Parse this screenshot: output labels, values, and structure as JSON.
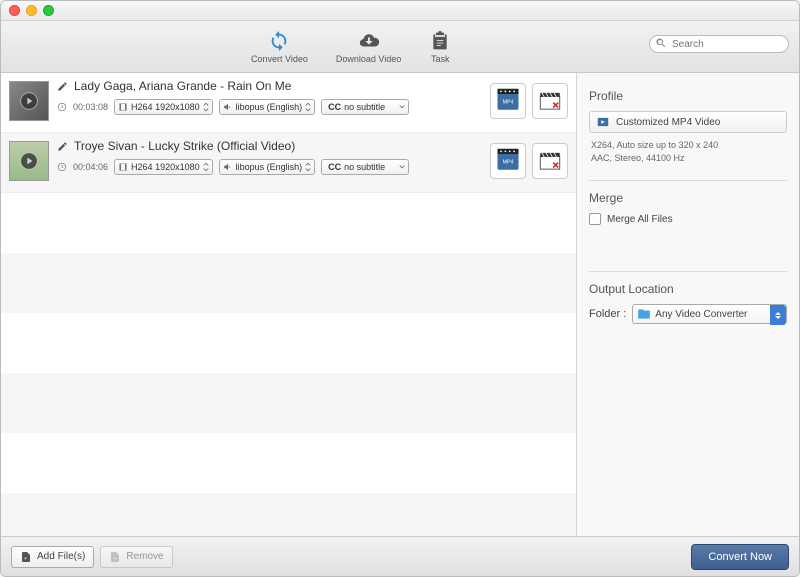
{
  "toolbar": {
    "convert_label": "Convert Video",
    "download_label": "Download Video",
    "task_label": "Task"
  },
  "search": {
    "placeholder": "Search"
  },
  "items": [
    {
      "title": "Lady Gaga, Ariana Grande - Rain On Me",
      "duration": "00:03:08",
      "format": "H264 1920x1080",
      "audio": "libopus (English)",
      "subtitle": "no subtitle"
    },
    {
      "title": "Troye Sivan - Lucky Strike (Official Video)",
      "duration": "00:04:06",
      "format": "H264 1920x1080",
      "audio": "libopus (English)",
      "subtitle": "no subtitle"
    }
  ],
  "sidebar": {
    "profile_heading": "Profile",
    "profile_name": "Customized MP4 Video",
    "profile_detail_line1": "X264, Auto size up to 320 x 240",
    "profile_detail_line2": "AAC, Stereo, 44100 Hz",
    "merge_heading": "Merge",
    "merge_checkbox_label": "Merge All Files",
    "output_heading": "Output Location",
    "output_label": "Folder :",
    "output_value": "Any Video Converter"
  },
  "footer": {
    "add_label": "Add File(s)",
    "remove_label": "Remove",
    "convert_label": "Convert Now"
  },
  "cc_prefix": "CC"
}
